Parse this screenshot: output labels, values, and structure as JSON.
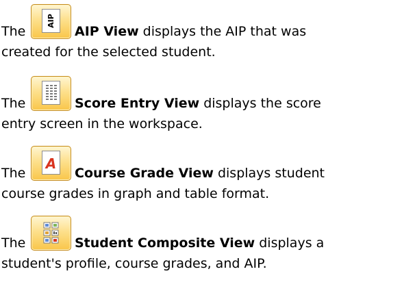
{
  "entries": [
    {
      "prefix": "The",
      "icon": "aip-view-icon",
      "icon_text": "AIP",
      "name": "AIP View",
      "line1_rest": " displays the AIP that was",
      "line2": "created for the selected student."
    },
    {
      "prefix": "The",
      "icon": "score-entry-view-icon",
      "name": "Score Entry View",
      "line1_rest": " displays the score",
      "line2": "entry screen in the workspace."
    },
    {
      "prefix": "The",
      "icon": "course-grade-view-icon",
      "icon_text": "A",
      "name": "Course Grade View",
      "line1_rest": " displays student",
      "line2": "course grades in graph and table format."
    },
    {
      "prefix": "The",
      "icon": "student-composite-view-icon",
      "name": "Student Composite View",
      "line1_rest": " displays a",
      "line2": "student's profile, course grades, and AIP."
    }
  ],
  "colors": {
    "icon_border": "#c48a1c",
    "icon_fill": "#fde08c",
    "text": "#000000",
    "course_grade_red": "#d9341f"
  }
}
